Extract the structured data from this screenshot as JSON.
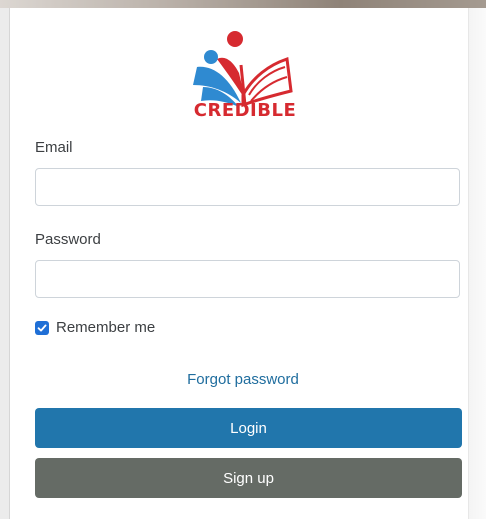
{
  "brand": {
    "logo_text": "CREDIBLE",
    "colors": {
      "red": "#d62a30",
      "blue": "#2f8ad1"
    }
  },
  "form": {
    "email_label": "Email",
    "email_value": "",
    "password_label": "Password",
    "password_value": "",
    "remember_label": "Remember me",
    "remember_checked": true,
    "forgot_label": "Forgot password",
    "login_label": "Login",
    "signup_label": "Sign up"
  },
  "colors": {
    "login_button": "#2176ac",
    "signup_button": "#656b65",
    "link": "#1f6d9e",
    "checkbox": "#1f6fd6"
  }
}
